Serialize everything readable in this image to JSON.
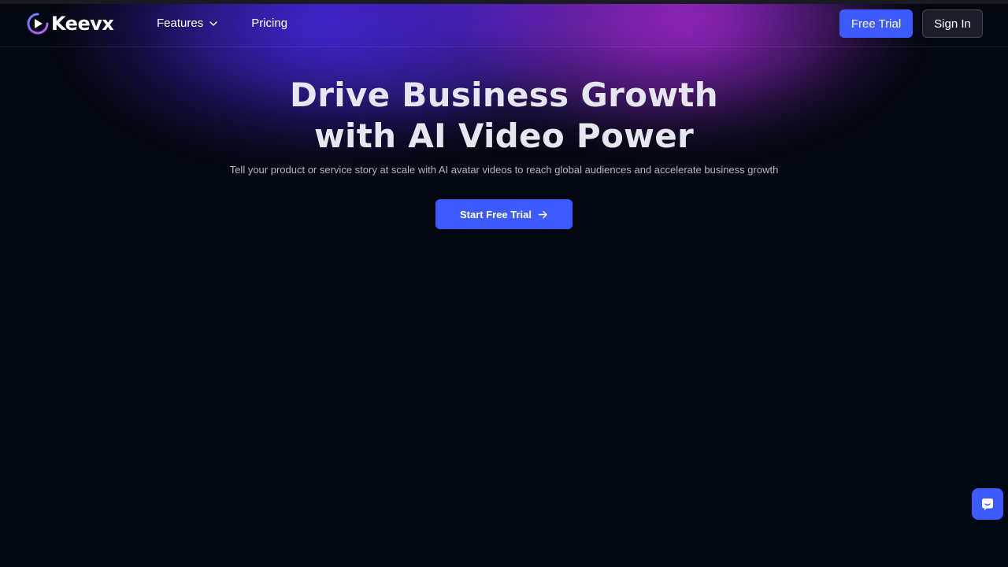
{
  "brand": {
    "name": "Keevx",
    "logo_icon": "play-logo-icon",
    "accent_color": "#3d5afe",
    "background_color": "#040812"
  },
  "nav": {
    "items": [
      {
        "label": "Features",
        "icon": "chevron-down-icon"
      },
      {
        "label": "Pricing"
      }
    ]
  },
  "header_actions": {
    "free_trial_label": "Free Trial",
    "sign_in_label": "Sign In"
  },
  "hero": {
    "title_line1": "Drive Business Growth",
    "title_line2": "with AI Video Power",
    "subtitle": "Tell your product or service story at scale with AI avatar videos to reach global audiences and accelerate business growth",
    "cta_label": "Start Free Trial",
    "cta_icon": "arrow-right-icon"
  },
  "chat_widget": {
    "icon": "chat-icon"
  }
}
